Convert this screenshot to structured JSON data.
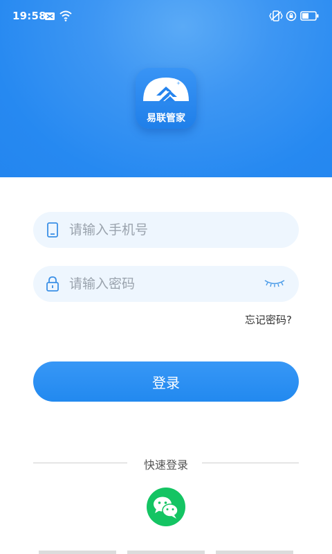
{
  "status_bar": {
    "time": "19:58"
  },
  "logo": {
    "app_name": "易联管家"
  },
  "phone_field": {
    "placeholder": "请输入手机号"
  },
  "password_field": {
    "placeholder": "请输入密码"
  },
  "forgot_password": "忘记密码?",
  "login_button": "登录",
  "quick_login": {
    "label": "快速登录",
    "options": [
      "wechat"
    ]
  },
  "colors": {
    "header_blue": "#2689f1",
    "button_blue": "#2289ef",
    "field_bg": "#eef6fe",
    "wechat_green": "#14c463"
  },
  "icons": {
    "phone": "phone-icon",
    "lock": "lock-icon",
    "eye": "eye-closed-icon",
    "wechat": "wechat-icon"
  }
}
